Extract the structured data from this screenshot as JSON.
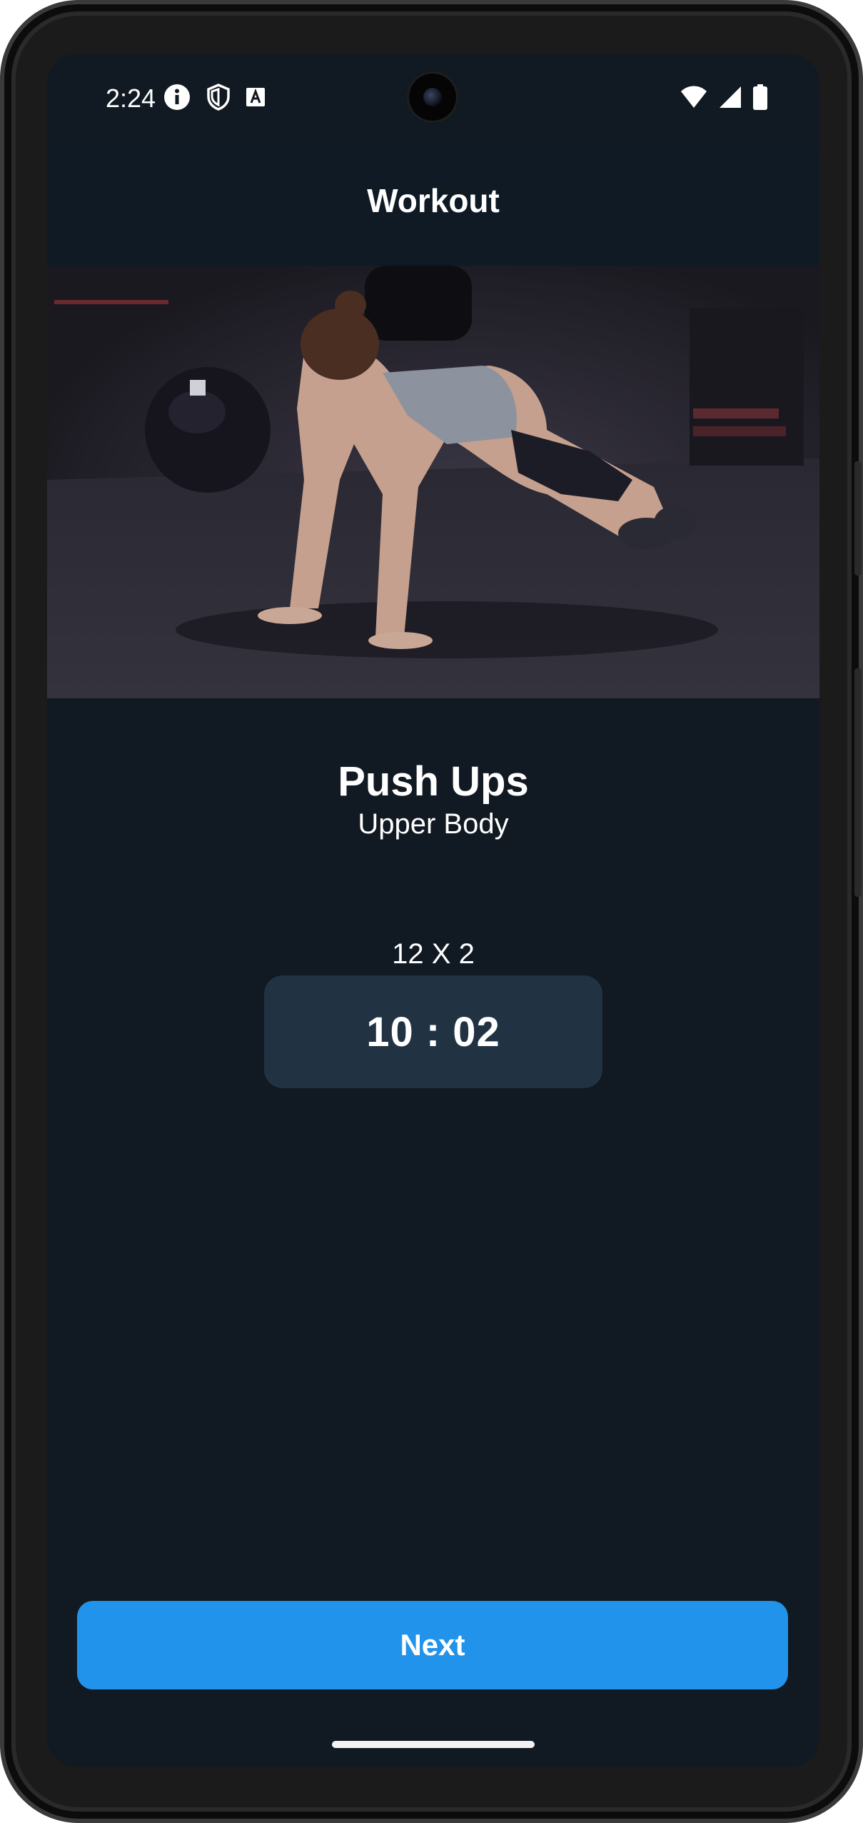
{
  "status_bar": {
    "time": "2:24",
    "left_icons": [
      "info-icon",
      "shield-icon",
      "keyboard-a-icon"
    ],
    "right_icons": [
      "wifi-icon",
      "cellular-signal-icon",
      "battery-icon"
    ]
  },
  "app_bar": {
    "title": "Workout"
  },
  "hero_image": {
    "subject": "person doing push ups in gym"
  },
  "exercise": {
    "name": "Push Ups",
    "category": "Upper Body",
    "reps": "12 X 2",
    "timer": "10 : 02"
  },
  "actions": {
    "next_label": "Next"
  },
  "colors": {
    "background": "#111922",
    "app_bar": "#0f1a24",
    "timer_box": "#213243",
    "accent": "#2193ea",
    "text": "#ffffff"
  }
}
